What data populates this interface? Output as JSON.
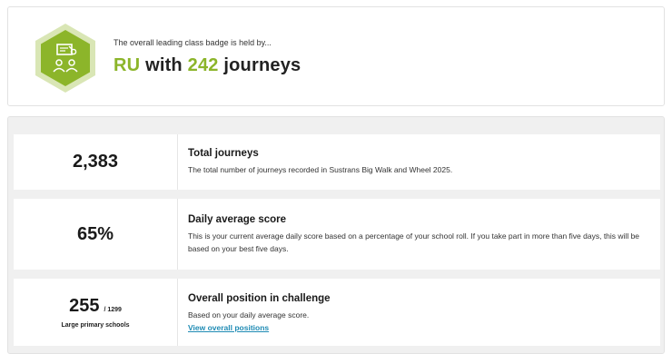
{
  "badge": {
    "intro": "The overall leading class badge is held by...",
    "class_name": "RU",
    "with_text": "with",
    "journeys_count": "242",
    "journeys_label": "journeys",
    "icon": "class-group-icon",
    "colors": {
      "hex_outer": "#d9e6b5",
      "hex_inner": "#8cb52a",
      "accent_text": "#8cb52a"
    }
  },
  "stats": {
    "total": {
      "value": "2,383",
      "title": "Total journeys",
      "description": "The total number of journeys recorded in Sustrans Big Walk and Wheel 2025."
    },
    "daily": {
      "value": "65%",
      "title": "Daily average score",
      "description": "This is your current average daily score based on a percentage of your school roll. If you take part in more than five days, this will be based on your best five days."
    },
    "position": {
      "value": "255",
      "of_total": "/ 1299",
      "category": "Large primary schools",
      "title": "Overall position in challenge",
      "description": "Based on your daily average score.",
      "link_label": "View overall positions",
      "link_color": "#1f8bb4"
    }
  }
}
